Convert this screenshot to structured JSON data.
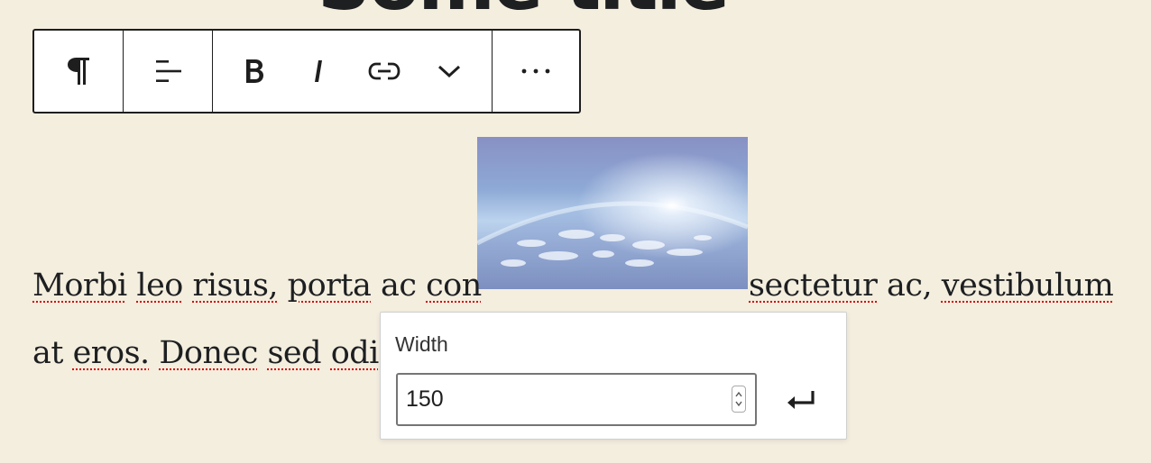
{
  "heading": {
    "text": "Some title"
  },
  "toolbar": {
    "items": [
      {
        "name": "paragraph",
        "icon": "pilcrow-icon"
      },
      {
        "name": "align",
        "icon": "align-left-icon"
      },
      {
        "name": "bold",
        "icon": "bold-icon"
      },
      {
        "name": "italic",
        "icon": "italic-icon"
      },
      {
        "name": "link",
        "icon": "link-icon"
      },
      {
        "name": "more-formatting",
        "icon": "chevron-down-icon"
      },
      {
        "name": "options",
        "icon": "ellipsis-icon"
      }
    ]
  },
  "image": {
    "alt": "Earth horizon seen from space"
  },
  "paragraph": {
    "line1": [
      "Morbi",
      "leo",
      "risus,",
      "porta",
      "ac",
      "con",
      "sectetur",
      "ac,",
      "vestibulum"
    ],
    "line2": [
      "at",
      "eros.",
      "Donec",
      "sed",
      "odi"
    ]
  },
  "width_popover": {
    "label": "Width",
    "value": "150",
    "submit_icon": "enter-icon"
  },
  "colors": {
    "background": "#f4eedf",
    "spellcheck": "#d30000"
  }
}
